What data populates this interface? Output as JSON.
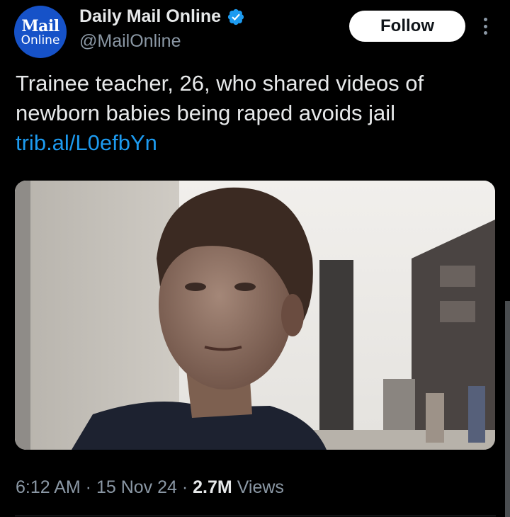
{
  "author": {
    "avatar_top": "Mail",
    "avatar_bottom": "Online",
    "display_name": "Daily Mail Online",
    "handle": "@MailOnline",
    "verified": true,
    "avatar_color": "#1652c8",
    "verified_color": "#1d9bf0"
  },
  "actions": {
    "follow_label": "Follow",
    "more_icon": "more-vertical-icon"
  },
  "tweet": {
    "text_line1": "Trainee teacher, 26, who shared videos of",
    "text_line2": "newborn babies being raped avoids jail",
    "link": "trib.al/L0efbYn",
    "link_color": "#1d9bf0"
  },
  "media": {
    "type": "photo"
  },
  "meta": {
    "time": "6:12 AM",
    "separator": " · ",
    "date": "15 Nov 24",
    "views_count": "2.7M",
    "views_label": "Views"
  }
}
